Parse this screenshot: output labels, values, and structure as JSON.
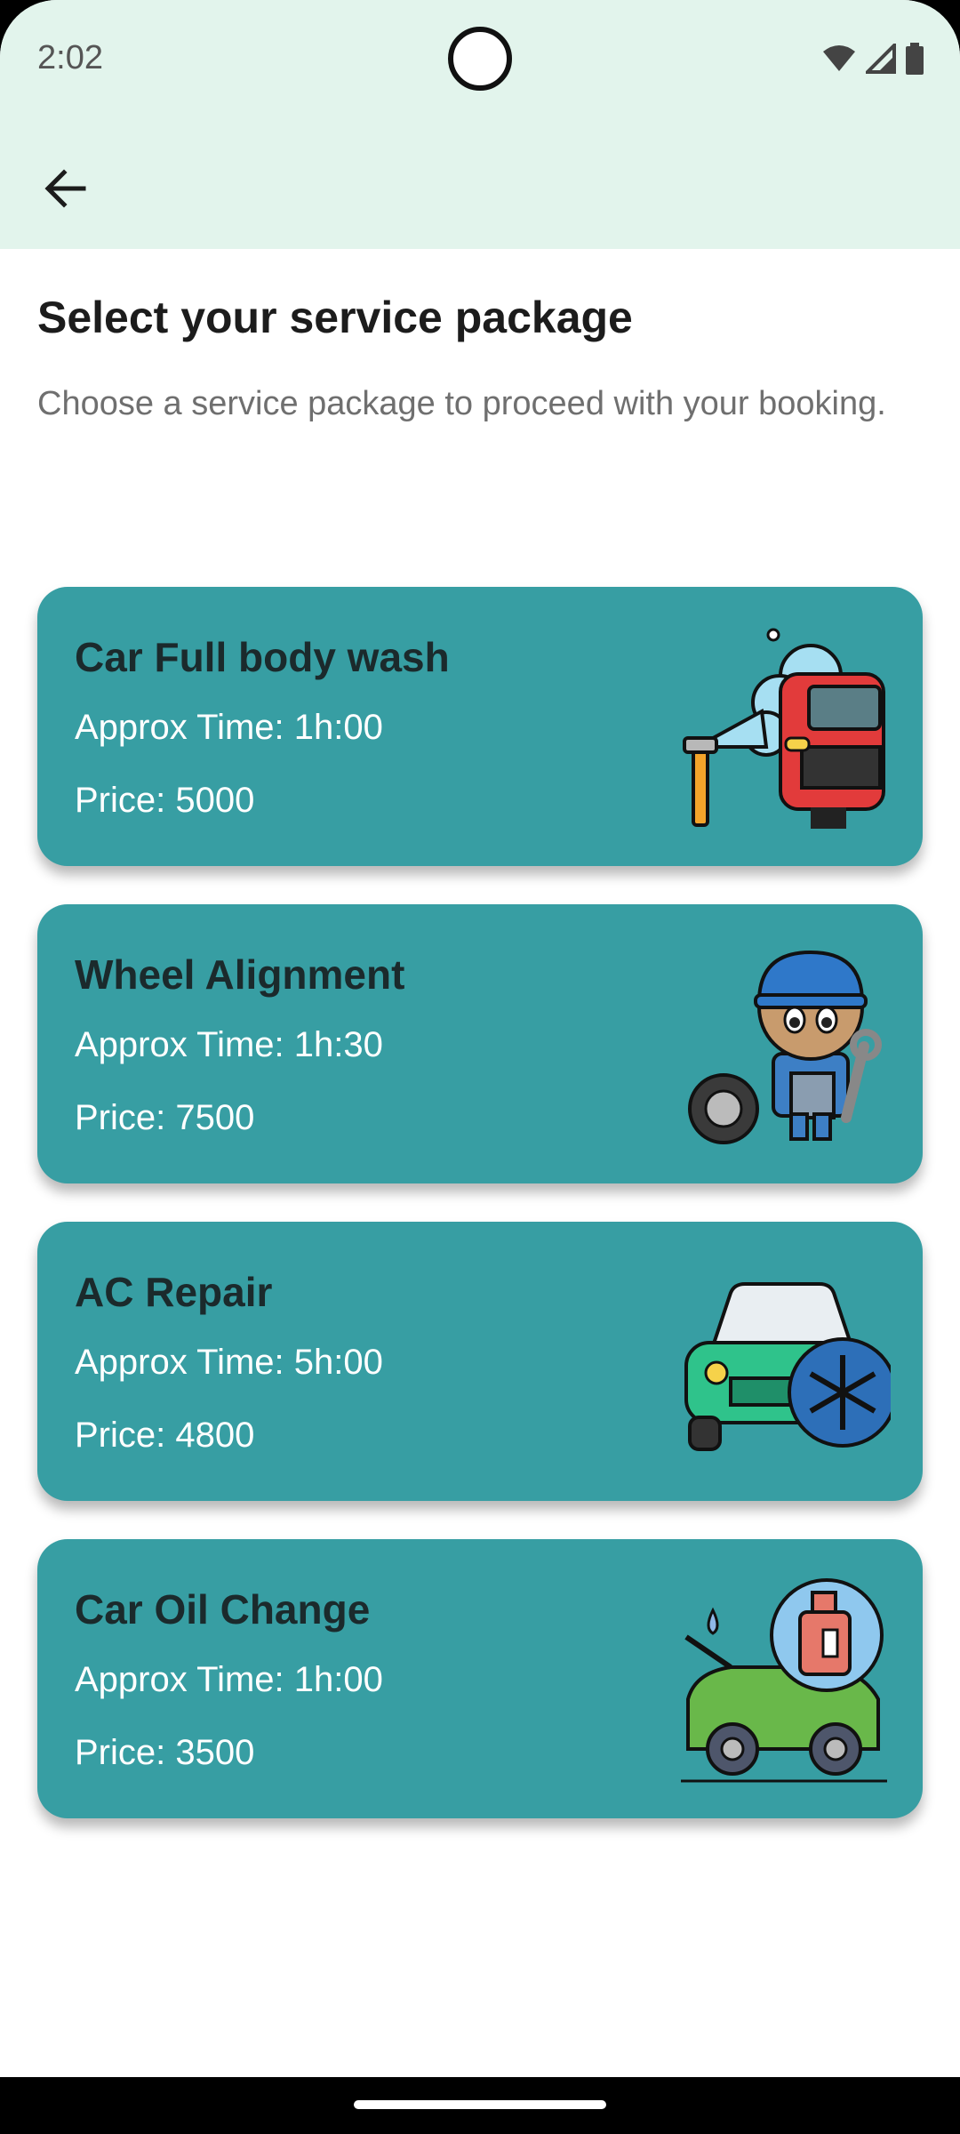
{
  "status_bar": {
    "time": "2:02",
    "icons": [
      "wifi-icon",
      "signal-icon",
      "battery-icon"
    ]
  },
  "app_bar": {
    "back_icon": "arrow-left-icon",
    "background": "#e2f4ec"
  },
  "header": {
    "title": "Select your service package",
    "subtitle": "Choose a service package to proceed with your booking."
  },
  "colors": {
    "card": "#379ea3",
    "card_title": "#1b2a2c",
    "card_text": "#ffffff"
  },
  "packages": [
    {
      "name": "Car Full body wash",
      "time": "Approx Time: 1h:00",
      "price": "Price: 5000",
      "icon": "car-wash-icon"
    },
    {
      "name": "Wheel Alignment",
      "time": "Approx Time: 1h:30",
      "price": "Price: 7500",
      "icon": "mechanic-icon"
    },
    {
      "name": "AC Repair",
      "time": "Approx Time: 5h:00",
      "price": "Price: 4800",
      "icon": "car-ac-icon"
    },
    {
      "name": "Car Oil Change",
      "time": "Approx Time: 1h:00",
      "price": "Price: 3500",
      "icon": "car-oil-icon"
    }
  ]
}
